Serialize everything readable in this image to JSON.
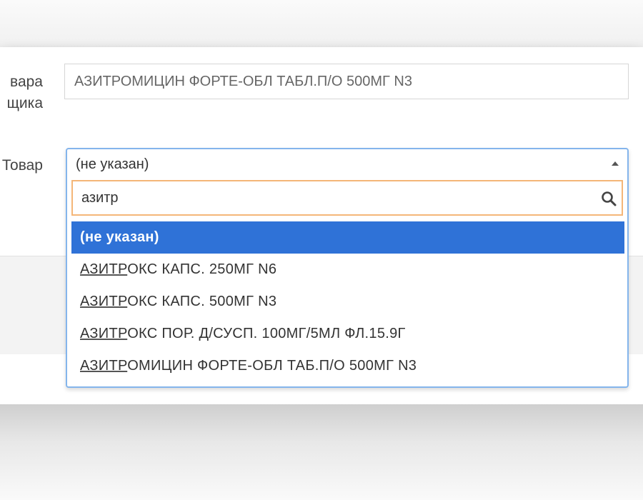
{
  "form": {
    "supplier_label_line1": "вара",
    "supplier_label_line2": "щика",
    "supplier_name_value": "АЗИТРОМИЦИН ФОРТЕ-ОБЛ ТАБЛ.П/О 500МГ N3",
    "product_label": "Товар"
  },
  "select": {
    "current_value": "(не указан)",
    "caret_icon": "triangle-up-icon",
    "search_value": "азитр",
    "search_icon": "magnifier-icon",
    "options": [
      {
        "match": "",
        "rest": "(не указан)",
        "selected": true
      },
      {
        "match": "АЗИТР",
        "rest": "ОКС КАПС. 250МГ N6",
        "selected": false
      },
      {
        "match": "АЗИТР",
        "rest": "ОКС КАПС. 500МГ N3",
        "selected": false
      },
      {
        "match": "АЗИТР",
        "rest": "ОКС ПОР. Д/СУСП. 100МГ/5МЛ ФЛ.15.9Г",
        "selected": false
      },
      {
        "match": "АЗИТР",
        "rest": "ОМИЦИН ФОРТЕ-ОБЛ ТАБ.П/О 500МГ N3",
        "selected": false
      }
    ]
  },
  "colors": {
    "selected_option_bg": "#2f72d7",
    "select_border": "#84b5ec",
    "search_focus_border": "#f4b678"
  }
}
